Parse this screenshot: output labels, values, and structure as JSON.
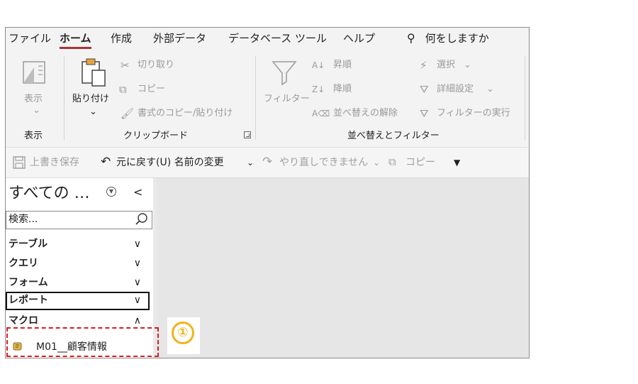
{
  "menu": {
    "items": [
      "ファイル",
      "ホーム",
      "作成",
      "外部データ",
      "データベース ツール",
      "ヘルプ"
    ],
    "active_index": 1,
    "search_label": "何をしますか"
  },
  "ribbon": {
    "views": {
      "button": "表示",
      "group": "表示"
    },
    "clipboard": {
      "paste": "貼り付け",
      "cut": "切り取り",
      "copy": "コピー",
      "format_painter": "書式のコピー/貼り付け",
      "group": "クリップボード"
    },
    "sort_filter": {
      "filter": "フィルター",
      "ascending": "昇順",
      "descending": "降順",
      "clear_sort": "並べ替えの解除",
      "selection": "選択",
      "advanced": "詳細設定",
      "toggle_filter": "フィルターの実行",
      "group": "並べ替えとフィルター"
    }
  },
  "qat": {
    "save": "上書き保存",
    "undo": "元に戻す(U) 名前の変更",
    "redo": "やり直しできません",
    "copy": "コピー"
  },
  "nav": {
    "title": "すべての …",
    "search_placeholder": "検索...",
    "groups": [
      {
        "label": "テーブル",
        "chevron": "∨"
      },
      {
        "label": "クエリ",
        "chevron": "∨"
      },
      {
        "label": "フォーム",
        "chevron": "∨"
      },
      {
        "label": "レポート",
        "chevron": "∨"
      },
      {
        "label": "マクロ",
        "chevron": "∧"
      }
    ],
    "items": [
      {
        "label": "M01__顧客情報"
      }
    ]
  },
  "annotation": {
    "callout": "①"
  },
  "colors": {
    "accent": "#a4373a",
    "highlight": "#d42020",
    "callout": "#f2b21b"
  }
}
